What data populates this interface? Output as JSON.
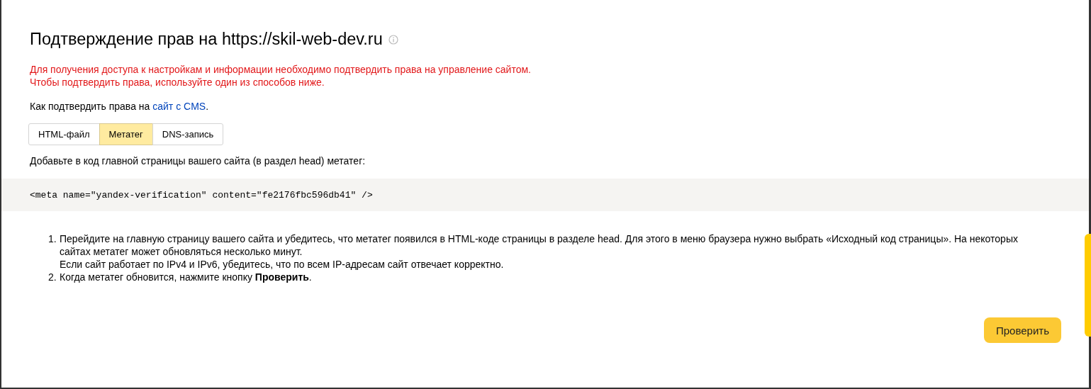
{
  "title": "Подтверждение прав на https://skil-web-dev.ru",
  "warning": [
    "Для получения доступа к настройкам и информации необходимо подтвердить права на управление сайтом.",
    "Чтобы подтвердить права, используйте один из способов ниже."
  ],
  "intro": {
    "text": "Как подтвердить права на ",
    "link": "сайт с CMS",
    "end": "."
  },
  "tabs": [
    {
      "label": "HTML-файл",
      "selected": false
    },
    {
      "label": "Метатег",
      "selected": true
    },
    {
      "label": "DNS-запись",
      "selected": false
    }
  ],
  "instruction": "Добавьте в код главной страницы вашего сайта (в раздел head) метатег:",
  "code": "<meta name=\"yandex-verification\" content=\"fe2176fbc596db41\" />",
  "steps": [
    {
      "marker": "1.",
      "lines": [
        "Перейдите на главную страницу вашего сайта и убедитесь, что метатег появился в HTML-коде страницы в разделе head. Для этого в меню браузера нужно выбрать «Исходный код страницы». На некоторых сайтах метатег может обновляться несколько минут.",
        "Если сайт работает по IPv4 и IPv6, убедитесь, что по всем IP-адресам сайт отвечает корректно."
      ]
    },
    {
      "marker": "2.",
      "lines": [
        "Когда метатег обновится, нажмите кнопку **Проверить**."
      ]
    }
  ],
  "button": "Проверить"
}
